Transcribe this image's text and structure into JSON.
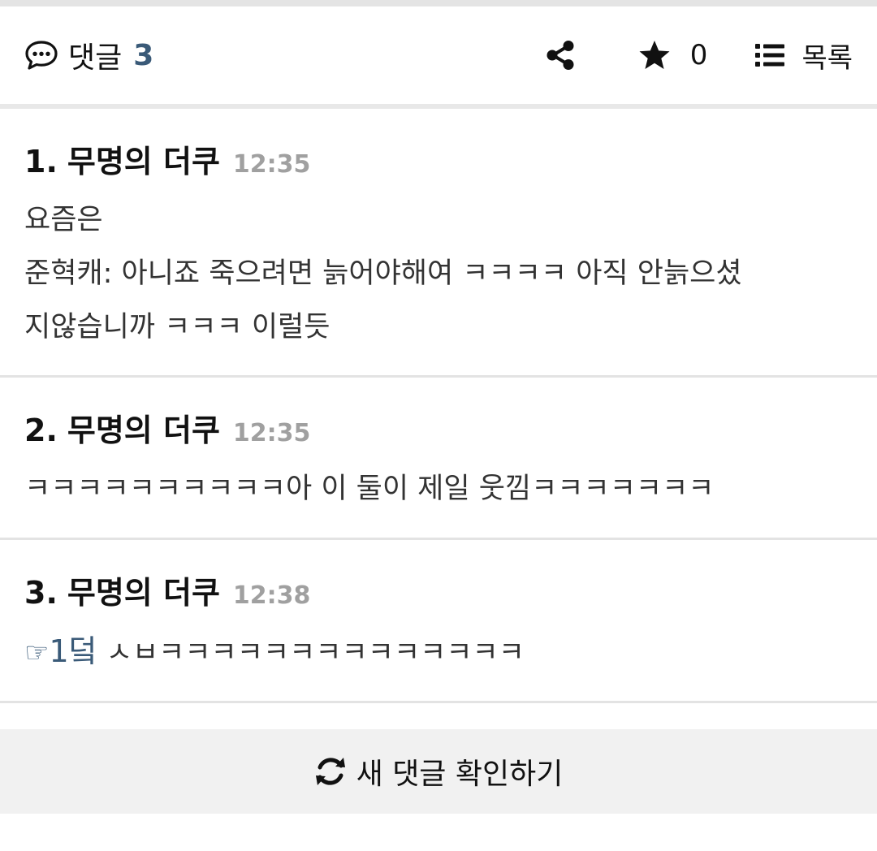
{
  "header": {
    "comment_label": "댓글",
    "comment_count": "3",
    "star_count": "0",
    "list_label": "목록",
    "icons": {
      "comment": "speech-bubble-icon",
      "share": "share-icon",
      "star": "star-icon",
      "list": "list-icon"
    }
  },
  "comments": [
    {
      "number": "1.",
      "author": "무명의 더쿠",
      "time": "12:35",
      "body": "요즘은\n준혁캐: 아니죠 죽으려면 늙어야해여 ㅋㅋㅋㅋ 아직 안늙으셨\n지않습니까 ㅋㅋㅋ 이럴듯"
    },
    {
      "number": "2.",
      "author": "무명의 더쿠",
      "time": "12:35",
      "body": "ㅋㅋㅋㅋㅋㅋㅋㅋㅋㅋ아 이 둘이 제일 웃낌ㅋㅋㅋㅋㅋㅋㅋ"
    },
    {
      "number": "3.",
      "author": "무명의 더쿠",
      "time": "12:38",
      "reply_hand": "☞",
      "reply_ref": "1덬",
      "body": " ㅅㅂㅋㅋㅋㅋㅋㅋㅋㅋㅋㅋㅋㅋㅋㅋ"
    }
  ],
  "refresh": {
    "label": "새 댓글 확인하기",
    "icon": "refresh-icon"
  }
}
